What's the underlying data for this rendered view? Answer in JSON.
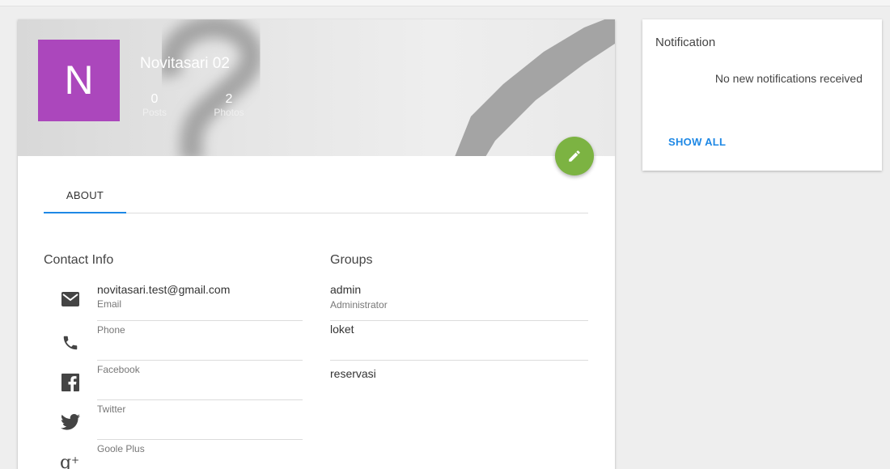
{
  "profile": {
    "avatar_letter": "N",
    "name": "Novitasari 02",
    "stats": [
      {
        "value": "0",
        "label": "Posts"
      },
      {
        "value": "2",
        "label": "Photos"
      }
    ],
    "avatar_color": "#ab47bc",
    "fab_color": "#7cb342"
  },
  "tabs": [
    {
      "label": "ABOUT",
      "active": true
    }
  ],
  "contact": {
    "title": "Contact Info",
    "items": [
      {
        "icon": "email-icon",
        "value": "novitasari.test@gmail.com",
        "label": "Email"
      },
      {
        "icon": "phone-icon",
        "value": "",
        "label": "Phone"
      },
      {
        "icon": "facebook-icon",
        "value": "",
        "label": "Facebook"
      },
      {
        "icon": "twitter-icon",
        "value": "",
        "label": "Twitter"
      },
      {
        "icon": "google-plus-icon",
        "value": "",
        "label": "Goole Plus"
      }
    ]
  },
  "groups": {
    "title": "Groups",
    "items": [
      {
        "name": "admin",
        "description": "Administrator"
      },
      {
        "name": "loket",
        "description": ""
      },
      {
        "name": "reservasi",
        "description": ""
      }
    ]
  },
  "notification": {
    "title": "Notification",
    "empty_text": "No new notifications received",
    "show_all_label": "SHOW ALL"
  },
  "colors": {
    "accent": "#1e88e5",
    "background": "#eeeeee"
  }
}
